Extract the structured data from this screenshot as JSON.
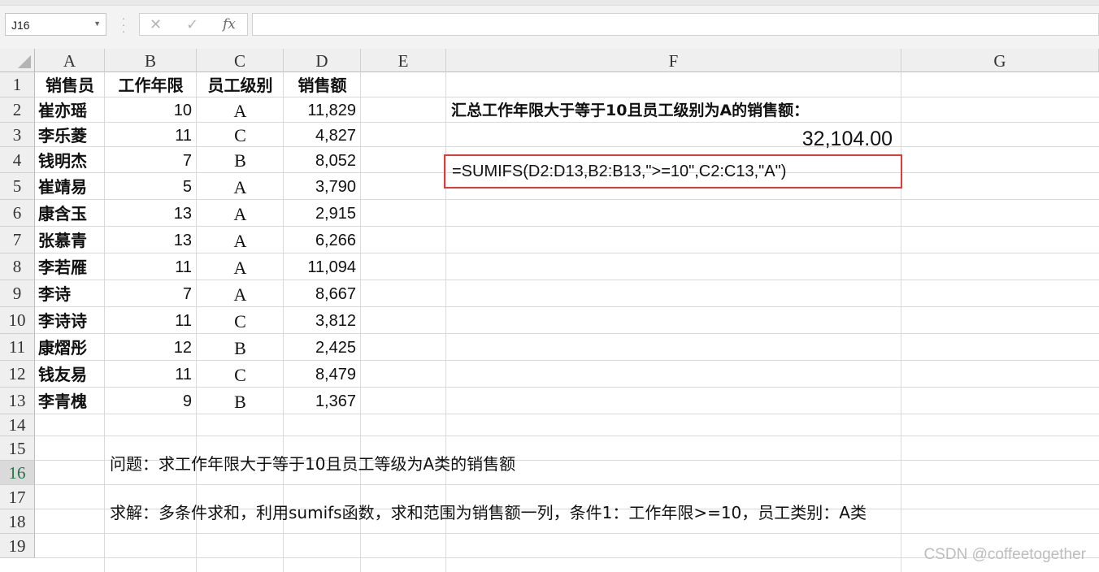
{
  "name_box": {
    "value": "J16"
  },
  "formula_bar": {
    "cancel_glyph": "✕",
    "enter_glyph": "✓",
    "fx_label": "fx",
    "value": ""
  },
  "columns": [
    "A",
    "B",
    "C",
    "D",
    "E",
    "F",
    "G"
  ],
  "rows": [
    "1",
    "2",
    "3",
    "4",
    "5",
    "6",
    "7",
    "8",
    "9",
    "10",
    "11",
    "12",
    "13",
    "14",
    "15",
    "16",
    "17",
    "18",
    "19"
  ],
  "selected_row": "16",
  "table": {
    "headers": [
      "销售员",
      "工作年限",
      "员工级别",
      "销售额"
    ],
    "records": [
      {
        "name": "崔亦瑶",
        "years": "10",
        "grade": "A",
        "sales": "11,829"
      },
      {
        "name": "李乐菱",
        "years": "11",
        "grade": "C",
        "sales": "4,827"
      },
      {
        "name": "钱明杰",
        "years": "7",
        "grade": "B",
        "sales": "8,052"
      },
      {
        "name": "崔靖易",
        "years": "5",
        "grade": "A",
        "sales": "3,790"
      },
      {
        "name": "康含玉",
        "years": "13",
        "grade": "A",
        "sales": "2,915"
      },
      {
        "name": "张慕青",
        "years": "13",
        "grade": "A",
        "sales": "6,266"
      },
      {
        "name": "李若雁",
        "years": "11",
        "grade": "A",
        "sales": "11,094"
      },
      {
        "name": "李诗",
        "years": "7",
        "grade": "A",
        "sales": "8,667"
      },
      {
        "name": "李诗诗",
        "years": "11",
        "grade": "C",
        "sales": "3,812"
      },
      {
        "name": "康熠彤",
        "years": "12",
        "grade": "B",
        "sales": "2,425"
      },
      {
        "name": "钱友易",
        "years": "11",
        "grade": "C",
        "sales": "8,479"
      },
      {
        "name": "李青槐",
        "years": "9",
        "grade": "B",
        "sales": "1,367"
      }
    ]
  },
  "f2_text": "汇总工作年限大于等于10且员工级别为A的销售额：",
  "f3_result": "32,104.00",
  "f4_formula": "=SUMIFS(D2:D13,B2:B13,\">=10\",C2:C13,\"A\")",
  "b15_question": "问题：求工作年限大于等于10且员工等级为A类的销售额",
  "b17_solution": "求解：多条件求和，利用sumifs函数，求和范围为销售额一列，条件1：工作年限>=10，员工类别：A类",
  "watermark": "CSDN @coffeetogether",
  "colors": {
    "highlight_box": "#e03a3a",
    "header_bg": "#efefef",
    "gridline": "#d9d9d9"
  }
}
